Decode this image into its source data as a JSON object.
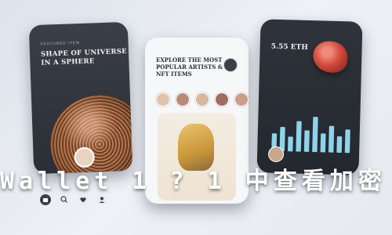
{
  "left_phone": {
    "eyebrow": "FEATURED ITEM",
    "title": "SHAPE OF UNIVERSE IN A SPHERE",
    "creator_name": "",
    "creator_sub": ""
  },
  "middle_phone": {
    "eyebrow": "",
    "title": "EXPLORE THE MOST POPULAR ARTISTS & NFT ITEMS",
    "card_title": "",
    "card_meta": ""
  },
  "right_phone": {
    "label": "",
    "value": "5.55 ETH",
    "sub": ""
  },
  "overlay": {
    "caption": "Wallet 1 ? 1 中查看加密"
  },
  "colors": {
    "background": "#e7ebf1",
    "dark_phone": "#2f343c",
    "accent_bar": "#8fd3ea"
  },
  "chart_bars": [
    0.45,
    0.62,
    0.38,
    0.78,
    0.55,
    0.9,
    0.48,
    0.68,
    0.42,
    0.6
  ]
}
